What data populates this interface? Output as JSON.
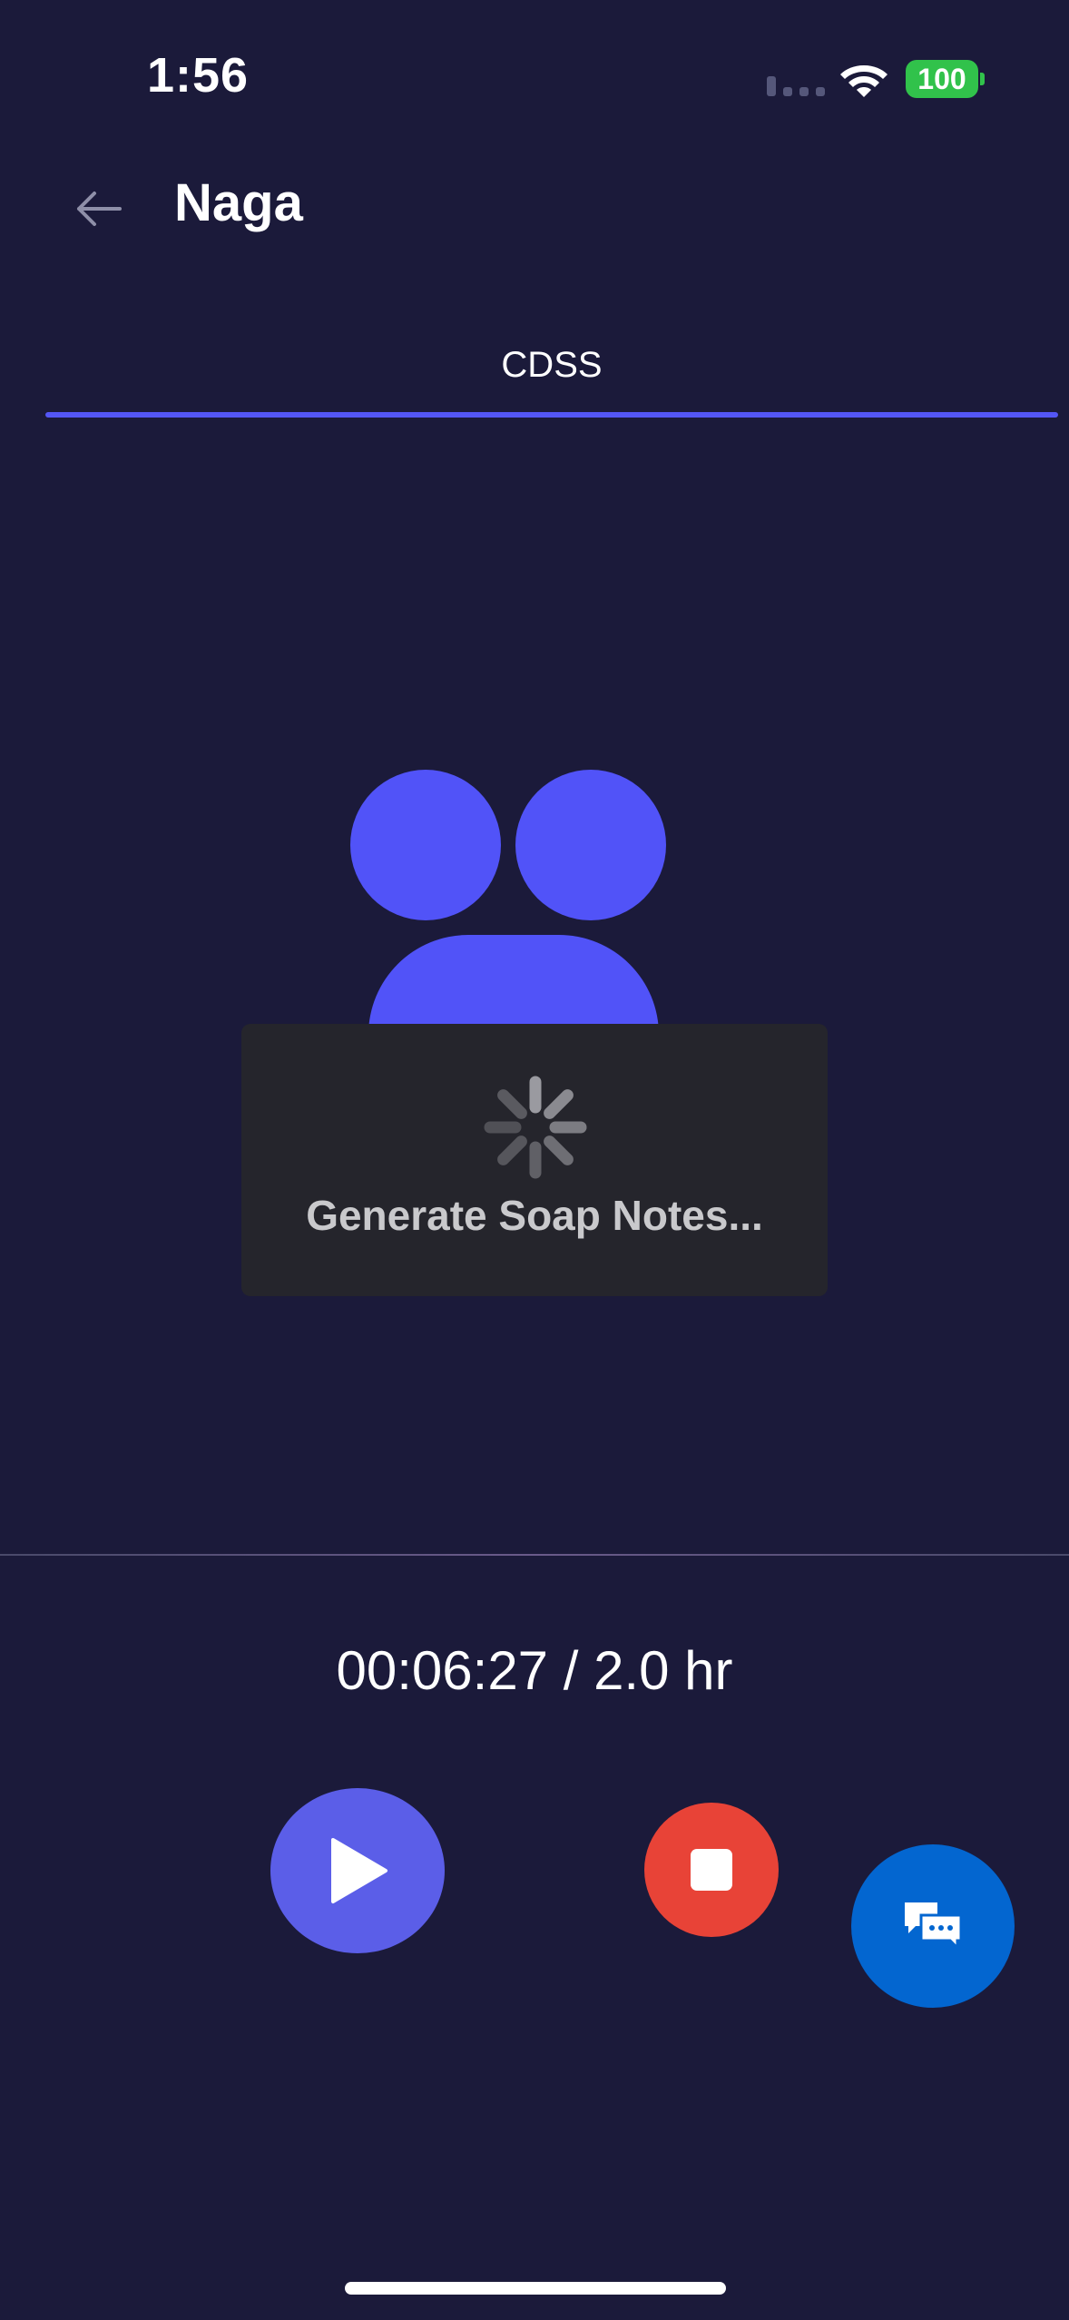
{
  "status_bar": {
    "time": "1:56",
    "battery": "100",
    "icons": [
      "signal-icon",
      "wifi-icon",
      "battery-icon"
    ]
  },
  "header": {
    "title": "Naga",
    "back_icon": "arrow-left-icon"
  },
  "tabs": [
    {
      "label": "CDSS",
      "active": true
    }
  ],
  "loading": {
    "message": "Generate Soap Notes..."
  },
  "recording": {
    "timer": "00:06:27 / 2.0 hr"
  },
  "controls": {
    "play_icon": "play-icon",
    "stop_icon": "stop-icon",
    "chat_icon": "chat-bubbles-icon"
  },
  "colors": {
    "background": "#1b1a3a",
    "accent": "#5456f5",
    "play": "#5b5ee8",
    "stop": "#e84337",
    "chat": "#0366d0",
    "battery": "#31c24b"
  }
}
